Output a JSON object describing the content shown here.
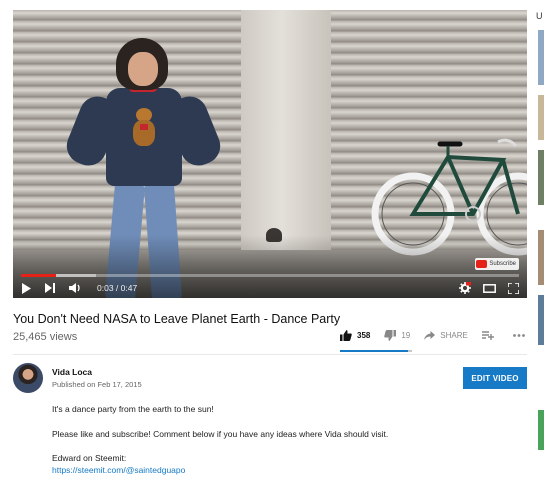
{
  "player": {
    "watermark_label": "Subscribe",
    "time_current": "0:03",
    "time_total": "0:47",
    "played_fraction": 0.07,
    "loaded_fraction": 0.15
  },
  "video": {
    "title": "You Don't Need NASA to Leave Planet Earth - Dance Party",
    "views": "25,465 views",
    "likes": "358",
    "dislikes": "19",
    "share_label": "SHARE",
    "like_ratio": 0.95
  },
  "channel": {
    "name": "Vida Loca",
    "published": "Published on Feb 17, 2015",
    "edit_button": "EDIT VIDEO"
  },
  "description": {
    "line1": "It's a dance party from the earth to the sun!",
    "line2": "Please like and subscribe! Comment below if you have any ideas where Vida should visit.",
    "line3": "Edward on Steemit:",
    "link": "https://steemit.com/@saintedguapo"
  },
  "sidebar": {
    "header_fragment": "U"
  },
  "colors": {
    "accent": "#167ac6",
    "progress_red": "#e62117"
  }
}
